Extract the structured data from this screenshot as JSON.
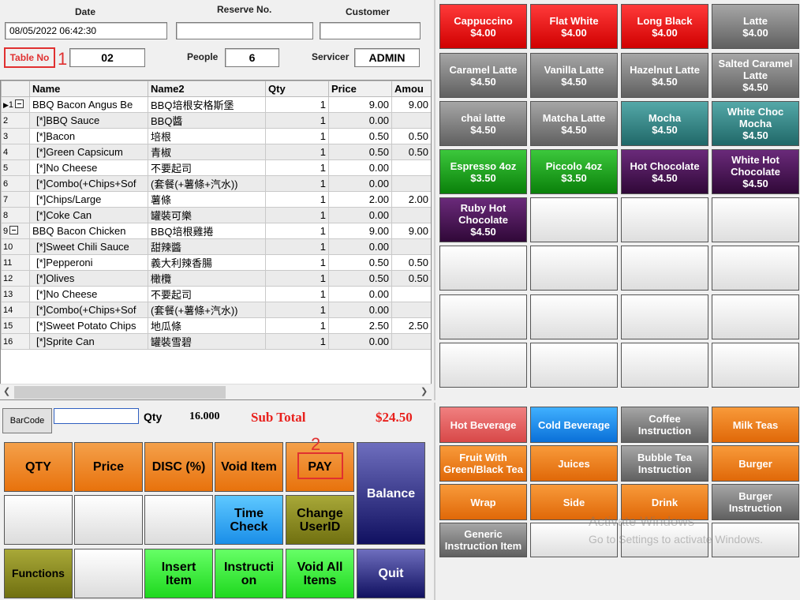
{
  "header": {
    "date_label": "Date",
    "date_value": "08/05/2022 06:42:30",
    "reserve_label": "Reserve No.",
    "reserve_value": "",
    "customer_label": "Customer",
    "customer_value": "",
    "table_label": "Table No",
    "table_value": "02",
    "people_label": "People",
    "people_value": "6",
    "servicer_label": "Servicer",
    "servicer_value": "ADMIN",
    "annotation_1": "1",
    "annotation_2": "2"
  },
  "grid": {
    "columns": [
      "Name",
      "Name2",
      "Qty",
      "Price",
      "Amou"
    ],
    "rows": [
      {
        "no": "1",
        "name": "BBQ Bacon Angus Be",
        "name2": "BBQ培根安格斯堡",
        "qty": "1",
        "price": "9.00",
        "amount": "9.00"
      },
      {
        "no": "2",
        "name": "[*]BBQ Sauce",
        "name2": "BBQ醬",
        "qty": "1",
        "price": "0.00",
        "amount": ""
      },
      {
        "no": "3",
        "name": "[*]Bacon",
        "name2": "培根",
        "qty": "1",
        "price": "0.50",
        "amount": "0.50"
      },
      {
        "no": "4",
        "name": "[*]Green Capsicum",
        "name2": "青椒",
        "qty": "1",
        "price": "0.50",
        "amount": "0.50"
      },
      {
        "no": "5",
        "name": "[*]No Cheese",
        "name2": "不要起司",
        "qty": "1",
        "price": "0.00",
        "amount": ""
      },
      {
        "no": "6",
        "name": "[*]Combo(+Chips+Sof",
        "name2": "(套餐(+薯條+汽水))",
        "qty": "1",
        "price": "0.00",
        "amount": ""
      },
      {
        "no": "7",
        "name": "[*]Chips/Large",
        "name2": "薯條",
        "qty": "1",
        "price": "2.00",
        "amount": "2.00"
      },
      {
        "no": "8",
        "name": "[*]Coke Can",
        "name2": "罐裝可樂",
        "qty": "1",
        "price": "0.00",
        "amount": ""
      },
      {
        "no": "9",
        "name": "BBQ Bacon Chicken",
        "name2": "BBQ培根雞捲",
        "qty": "1",
        "price": "9.00",
        "amount": "9.00"
      },
      {
        "no": "10",
        "name": "[*]Sweet Chili Sauce",
        "name2": "甜辣醬",
        "qty": "1",
        "price": "0.00",
        "amount": ""
      },
      {
        "no": "11",
        "name": "[*]Pepperoni",
        "name2": "義大利辣香腸",
        "qty": "1",
        "price": "0.50",
        "amount": "0.50"
      },
      {
        "no": "12",
        "name": "[*]Olives",
        "name2": "橄欖",
        "qty": "1",
        "price": "0.50",
        "amount": "0.50"
      },
      {
        "no": "13",
        "name": "[*]No Cheese",
        "name2": "不要起司",
        "qty": "1",
        "price": "0.00",
        "amount": ""
      },
      {
        "no": "14",
        "name": "[*]Combo(+Chips+Sof",
        "name2": "(套餐(+薯條+汽水))",
        "qty": "1",
        "price": "0.00",
        "amount": ""
      },
      {
        "no": "15",
        "name": "[*]Sweet Potato Chips",
        "name2": "地瓜條",
        "qty": "1",
        "price": "2.50",
        "amount": "2.50"
      },
      {
        "no": "16",
        "name": "[*]Sprite Can",
        "name2": "罐裝雪碧",
        "qty": "1",
        "price": "0.00",
        "amount": ""
      }
    ]
  },
  "barcode": {
    "button_label": "BarCode",
    "input_value": "",
    "qty_label": "Qty",
    "qty_value": "16.000",
    "subtotal_label": "Sub Total",
    "subtotal_value": "$24.50"
  },
  "functions": {
    "qty": "QTY",
    "price": "Price",
    "disc": "DISC (%)",
    "void_item": "Void Item",
    "pay": "PAY",
    "balance": "Balance",
    "time_check": "Time Check",
    "change_user": "Change UserID",
    "functions": "Functions",
    "insert_item": "Insert Item",
    "instruction": "Instructi on",
    "void_all": "Void All Items",
    "quit": "Quit"
  },
  "products": [
    {
      "name": "Cappuccino",
      "price": "$4.00",
      "color": "#e81010"
    },
    {
      "name": "Flat White",
      "price": "$4.00",
      "color": "#e81010"
    },
    {
      "name": "Long Black",
      "price": "$4.00",
      "color": "#e81010"
    },
    {
      "name": "Latte",
      "price": "$4.00",
      "color": "#808080"
    },
    {
      "name": "Caramel Latte",
      "price": "$4.50",
      "color": "#808080"
    },
    {
      "name": "Vanilla Latte",
      "price": "$4.50",
      "color": "#808080"
    },
    {
      "name": "Hazelnut Latte",
      "price": "$4.50",
      "color": "#808080"
    },
    {
      "name": "Salted Caramel Latte",
      "price": "$4.50",
      "color": "#808080"
    },
    {
      "name": "chai latte",
      "price": "$4.50",
      "color": "#808080"
    },
    {
      "name": "Matcha Latte",
      "price": "$4.50",
      "color": "#808080"
    },
    {
      "name": "Mocha",
      "price": "$4.50",
      "color": "#2e8080"
    },
    {
      "name": "White Choc Mocha",
      "price": "$4.50",
      "color": "#2e8080"
    },
    {
      "name": "Espresso 4oz",
      "price": "$3.50",
      "color": "#1a9a1a"
    },
    {
      "name": "Piccolo 4oz",
      "price": "$3.50",
      "color": "#1a9a1a"
    },
    {
      "name": "Hot Chocolate",
      "price": "$4.50",
      "color": "#4a1456"
    },
    {
      "name": "White Hot Chocolate",
      "price": "$4.50",
      "color": "#4a1456"
    },
    {
      "name": "Ruby Hot Chocolate",
      "price": "$4.50",
      "color": "#4a1456"
    }
  ],
  "categories": [
    {
      "name": "Hot Beverage",
      "color": "#e06060"
    },
    {
      "name": "Cold Beverage",
      "color": "#1a8ee8"
    },
    {
      "name": "Coffee Instruction",
      "color": "#808080"
    },
    {
      "name": "Milk Teas",
      "color": "#e87a1a"
    },
    {
      "name": "Fruit With Green/Black Tea",
      "color": "#e87a1a"
    },
    {
      "name": "Juices",
      "color": "#e87a1a"
    },
    {
      "name": "Bubble Tea Instruction",
      "color": "#808080"
    },
    {
      "name": "Burger",
      "color": "#e87a1a"
    },
    {
      "name": "Wrap",
      "color": "#e87a1a"
    },
    {
      "name": "Side",
      "color": "#e87a1a"
    },
    {
      "name": "Drink",
      "color": "#e87a1a"
    },
    {
      "name": "Burger Instruction",
      "color": "#808080"
    },
    {
      "name": "Generic Instruction Item",
      "color": "#808080"
    }
  ],
  "watermark": {
    "line1": "Activate Windows",
    "line2": "Go to Settings to activate Windows."
  }
}
